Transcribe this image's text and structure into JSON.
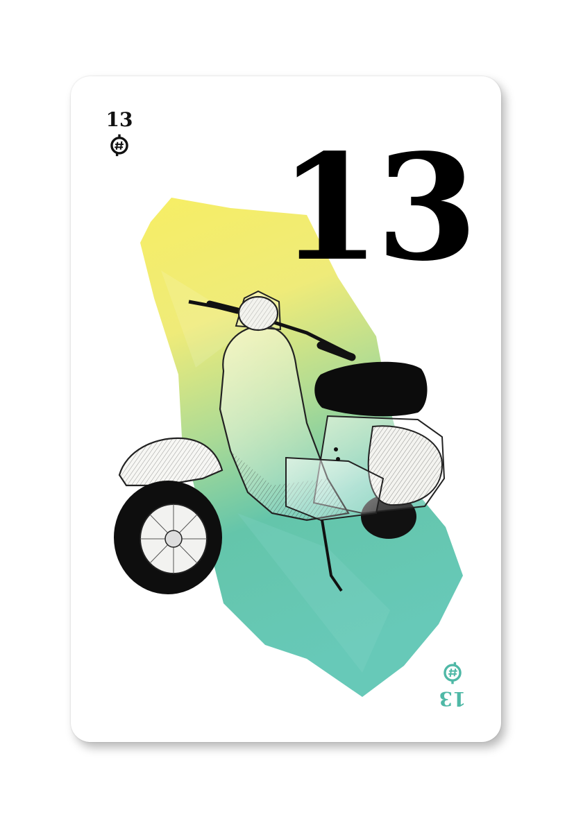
{
  "card": {
    "rank": "13",
    "corner_top_rank": "13",
    "corner_bottom_rank": "13",
    "suit_icon": "h-circle-icon",
    "illustration": "scooter-illustration",
    "colors": {
      "ink": "#111111",
      "accent_teal": "#4fb8a6",
      "wash_yellow": "#f5ea5a",
      "wash_teal": "#55c2ab"
    }
  }
}
